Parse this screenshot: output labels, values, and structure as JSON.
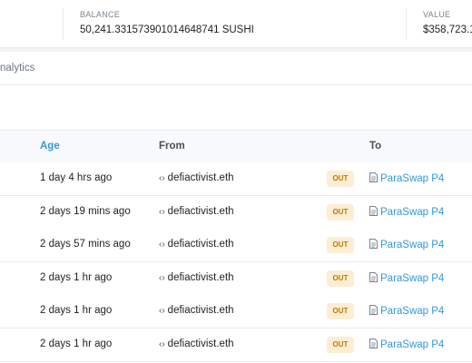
{
  "summary": {
    "balance_label": "BALANCE",
    "balance_value": "50,241.331573901014648741 SUSHI",
    "value_label": "VALUE",
    "value_value": "$358,723.1"
  },
  "tabs": {
    "analytics_label": "nalytics"
  },
  "table": {
    "columns": {
      "age": "Age",
      "from": "From",
      "to": "To"
    },
    "rows": [
      {
        "age": "1 day 4 hrs ago",
        "from": "defiactivist.eth",
        "direction": "OUT",
        "to": "ParaSwap P4"
      },
      {
        "age": "2 days 19 mins ago",
        "from": "defiactivist.eth",
        "direction": "OUT",
        "to": "ParaSwap P4"
      },
      {
        "age": "2 days 57 mins ago",
        "from": "defiactivist.eth",
        "direction": "OUT",
        "to": "ParaSwap P4"
      },
      {
        "age": "2 days 1 hr ago",
        "from": "defiactivist.eth",
        "direction": "OUT",
        "to": "ParaSwap P4"
      },
      {
        "age": "2 days 1 hr ago",
        "from": "defiactivist.eth",
        "direction": "OUT",
        "to": "ParaSwap P4"
      },
      {
        "age": "2 days 1 hr ago",
        "from": "defiactivist.eth",
        "direction": "OUT",
        "to": "ParaSwap P4"
      }
    ]
  },
  "colors": {
    "link": "#3498db",
    "out_badge_bg": "#fcedd3",
    "out_badge_text": "#b47d00"
  },
  "icons": {
    "from_icon": "code-icon",
    "to_icon": "document-icon"
  }
}
